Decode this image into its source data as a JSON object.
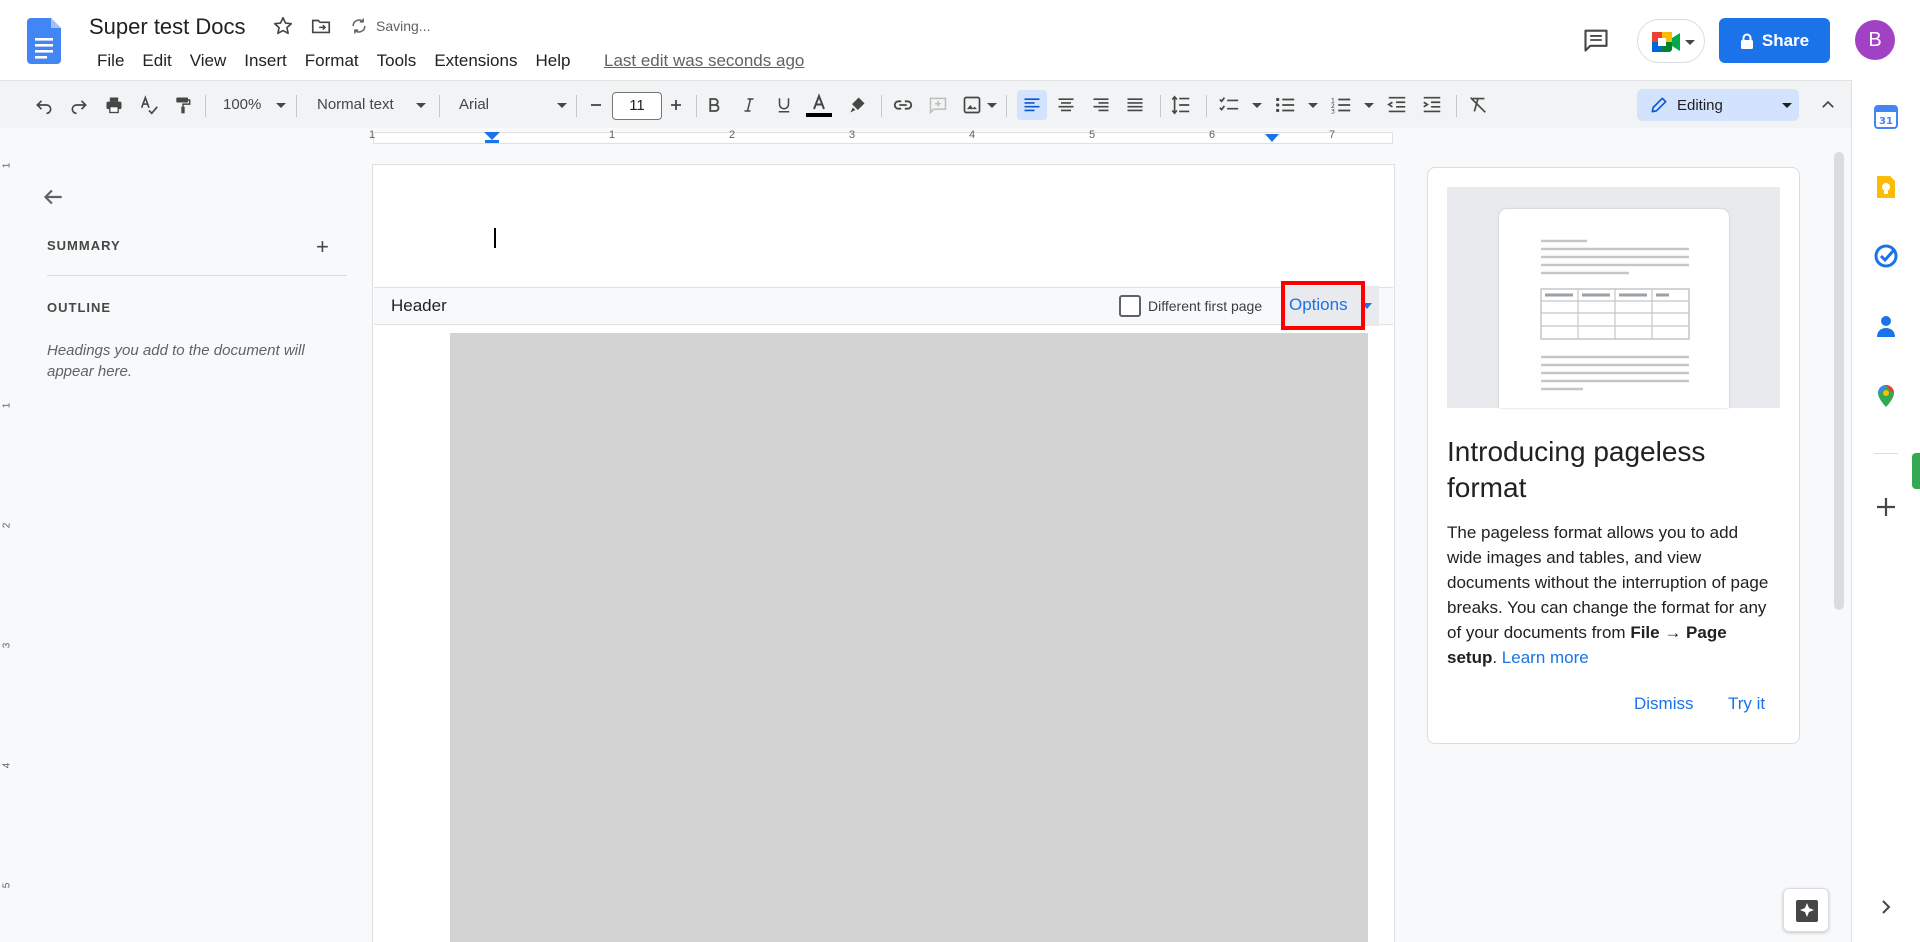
{
  "app": {
    "doc_title": "Super test Docs",
    "saving_status": "Saving...",
    "last_edit": "Last edit was seconds ago",
    "menu": [
      "File",
      "Edit",
      "View",
      "Insert",
      "Format",
      "Tools",
      "Extensions",
      "Help"
    ],
    "share_label": "Share",
    "avatar_initial": "B"
  },
  "toolbar": {
    "zoom": "100%",
    "style": "Normal text",
    "font": "Arial",
    "font_size": "11",
    "mode": "Editing"
  },
  "ruler": {
    "h_marks": [
      "1",
      "1",
      "2",
      "3",
      "4",
      "5",
      "6",
      "7"
    ],
    "v_marks": [
      "1",
      "1",
      "2",
      "3",
      "4",
      "5"
    ]
  },
  "outline": {
    "summary_label": "SUMMARY",
    "outline_label": "OUTLINE",
    "hint": "Headings you add to the document will appear here."
  },
  "document": {
    "header_label": "Header",
    "different_first_page": "Different first page",
    "options_label": "Options"
  },
  "promo": {
    "title": "Introducing pageless format",
    "body_start": "The pageless format allows you to add wide images and tables, and view documents without the interruption of page breaks. You can change the format for any of your documents from ",
    "body_bold": "File → Page setup",
    "body_sep": ". ",
    "learn_more": "Learn more",
    "dismiss": "Dismiss",
    "try_it": "Try it"
  },
  "colors": {
    "accent": "#1a73e8",
    "avatar": "#a142c4",
    "highlight": "#ff0000"
  },
  "icons": {
    "sidebar": [
      "calendar-icon",
      "keep-icon",
      "tasks-icon",
      "contacts-icon",
      "maps-icon",
      "add-icon"
    ]
  }
}
